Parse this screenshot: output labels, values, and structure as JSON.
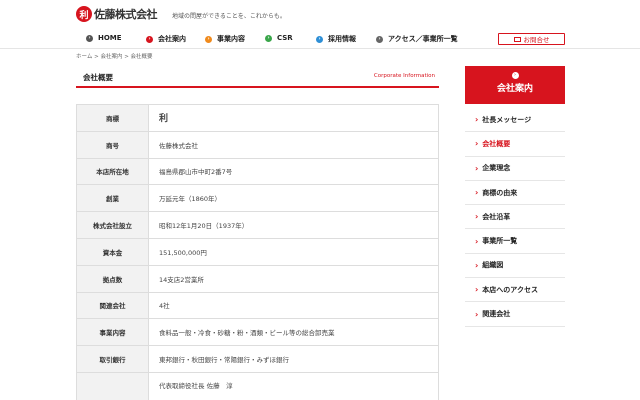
{
  "header": {
    "logo_mark": "利",
    "company_name": "佐藤株式会社",
    "tagline": "地域の問屋ができることを、これからも。"
  },
  "nav": {
    "items": [
      {
        "label": "HOME",
        "color": "#555555"
      },
      {
        "label": "会社案内",
        "color": "#d7141e"
      },
      {
        "label": "事業内容",
        "color": "#f08a1c"
      },
      {
        "label": "CSR",
        "color": "#3aa64a"
      },
      {
        "label": "採用情報",
        "color": "#2e8fd6"
      },
      {
        "label": "アクセス／事業所一覧",
        "color": "#666666"
      }
    ],
    "contact_label": "お問合せ"
  },
  "breadcrumb": "ホーム > 会社案内 > 会社概要",
  "page": {
    "title": "会社概要",
    "title_en": "Corporate Information"
  },
  "table": {
    "rows": [
      {
        "label": "商標",
        "value": "利"
      },
      {
        "label": "商号",
        "value": "佐藤株式会社"
      },
      {
        "label": "本店所在地",
        "value": "福島県郡山市中町2番7号"
      },
      {
        "label": "創業",
        "value": "万延元年（1860年）"
      },
      {
        "label": "株式会社設立",
        "value": "昭和12年1月20日（1937年）"
      },
      {
        "label": "資本金",
        "value": "151,500,000円"
      },
      {
        "label": "拠点数",
        "value": "14支店2営業所"
      },
      {
        "label": "関連会社",
        "value": "4社"
      },
      {
        "label": "事業内容",
        "value": "食料品一般・冷食・砂糖・粉・酒類・ビール等の総合卸売業"
      },
      {
        "label": "取引銀行",
        "value": "東邦銀行・秋田銀行・常陽銀行・みずほ銀行"
      },
      {
        "label": "",
        "value": "代表取締役社長 佐藤　淳"
      }
    ]
  },
  "sidebar": {
    "heading": "会社案内",
    "items": [
      {
        "label": "社長メッセージ"
      },
      {
        "label": "会社概要"
      },
      {
        "label": "企業理念"
      },
      {
        "label": "商標の由来"
      },
      {
        "label": "会社沿革"
      },
      {
        "label": "事業所一覧"
      },
      {
        "label": "組織図"
      },
      {
        "label": "本店へのアクセス"
      },
      {
        "label": "関連会社"
      }
    ],
    "active_index": 1
  },
  "colors": {
    "accent": "#d7141e"
  }
}
